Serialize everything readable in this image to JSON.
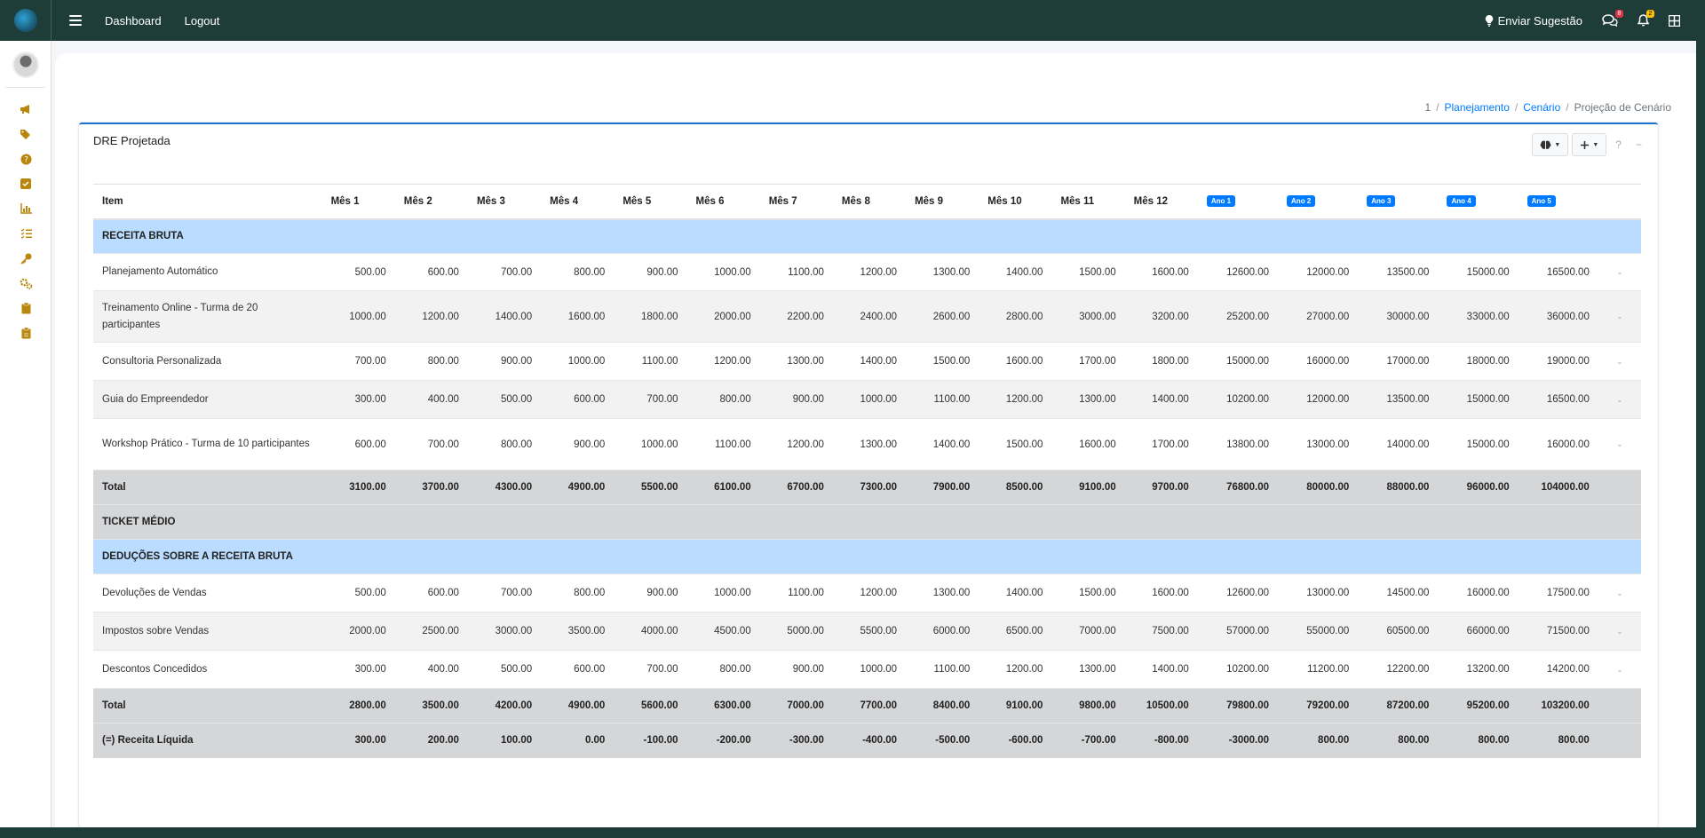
{
  "nav": {
    "dashboard": "Dashboard",
    "logout": "Logout",
    "suggest": "Enviar Sugestão",
    "chat_badge": "8",
    "bell_badge": "2"
  },
  "breadcrumb": {
    "home": "1",
    "planejamento": "Planejamento",
    "cenario": "Cenário",
    "current": "Projeção de Cenário"
  },
  "panel": {
    "title": "DRE Projetada",
    "help": "?",
    "collapse": "−"
  },
  "table": {
    "headers": [
      "Item",
      "Mês 1",
      "Mês 2",
      "Mês 3",
      "Mês 4",
      "Mês 5",
      "Mês 6",
      "Mês 7",
      "Mês 8",
      "Mês 9",
      "Mês 10",
      "Mês 11",
      "Mês 12"
    ],
    "years": [
      "Ano 1",
      "Ano 2",
      "Ano 3",
      "Ano 4",
      "Ano 5"
    ],
    "sections": {
      "receita": "RECEITA BRUTA",
      "ticket": "TICKET MÉDIO",
      "deducoes": "DEDUÇÕES SOBRE A RECEITA BRUTA"
    },
    "total_label": "Total",
    "receita_rows": [
      {
        "item": "Planejamento Automático",
        "values": [
          "500.00",
          "600.00",
          "700.00",
          "800.00",
          "900.00",
          "1000.00",
          "1100.00",
          "1200.00",
          "1300.00",
          "1400.00",
          "1500.00",
          "1600.00",
          "12600.00",
          "12000.00",
          "13500.00",
          "15000.00",
          "16500.00"
        ]
      },
      {
        "item": "Treinamento Online - Turma de 20 participantes",
        "values": [
          "1000.00",
          "1200.00",
          "1400.00",
          "1600.00",
          "1800.00",
          "2000.00",
          "2200.00",
          "2400.00",
          "2600.00",
          "2800.00",
          "3000.00",
          "3200.00",
          "25200.00",
          "27000.00",
          "30000.00",
          "33000.00",
          "36000.00"
        ]
      },
      {
        "item": "Consultoria Personalizada",
        "values": [
          "700.00",
          "800.00",
          "900.00",
          "1000.00",
          "1100.00",
          "1200.00",
          "1300.00",
          "1400.00",
          "1500.00",
          "1600.00",
          "1700.00",
          "1800.00",
          "15000.00",
          "16000.00",
          "17000.00",
          "18000.00",
          "19000.00"
        ]
      },
      {
        "item": "Guia do Empreendedor",
        "values": [
          "300.00",
          "400.00",
          "500.00",
          "600.00",
          "700.00",
          "800.00",
          "900.00",
          "1000.00",
          "1100.00",
          "1200.00",
          "1300.00",
          "1400.00",
          "10200.00",
          "12000.00",
          "13500.00",
          "15000.00",
          "16500.00"
        ]
      },
      {
        "item": "Workshop Prático - Turma de 10 participantes",
        "values": [
          "600.00",
          "700.00",
          "800.00",
          "900.00",
          "1000.00",
          "1100.00",
          "1200.00",
          "1300.00",
          "1400.00",
          "1500.00",
          "1600.00",
          "1700.00",
          "13800.00",
          "13000.00",
          "14000.00",
          "15000.00",
          "16000.00"
        ]
      }
    ],
    "receita_total": [
      "3100.00",
      "3700.00",
      "4300.00",
      "4900.00",
      "5500.00",
      "6100.00",
      "6700.00",
      "7300.00",
      "7900.00",
      "8500.00",
      "9100.00",
      "9700.00",
      "76800.00",
      "80000.00",
      "88000.00",
      "96000.00",
      "104000.00"
    ],
    "deducoes_rows": [
      {
        "item": "Devoluções de Vendas",
        "values": [
          "500.00",
          "600.00",
          "700.00",
          "800.00",
          "900.00",
          "1000.00",
          "1100.00",
          "1200.00",
          "1300.00",
          "1400.00",
          "1500.00",
          "1600.00",
          "12600.00",
          "13000.00",
          "14500.00",
          "16000.00",
          "17500.00"
        ]
      },
      {
        "item": "Impostos sobre Vendas",
        "values": [
          "2000.00",
          "2500.00",
          "3000.00",
          "3500.00",
          "4000.00",
          "4500.00",
          "5000.00",
          "5500.00",
          "6000.00",
          "6500.00",
          "7000.00",
          "7500.00",
          "57000.00",
          "55000.00",
          "60500.00",
          "66000.00",
          "71500.00"
        ]
      },
      {
        "item": "Descontos Concedidos",
        "values": [
          "300.00",
          "400.00",
          "500.00",
          "600.00",
          "700.00",
          "800.00",
          "900.00",
          "1000.00",
          "1100.00",
          "1200.00",
          "1300.00",
          "1400.00",
          "10200.00",
          "11200.00",
          "12200.00",
          "13200.00",
          "14200.00"
        ]
      }
    ],
    "deducoes_total": [
      "2800.00",
      "3500.00",
      "4200.00",
      "4900.00",
      "5600.00",
      "6300.00",
      "7000.00",
      "7700.00",
      "8400.00",
      "9100.00",
      "9800.00",
      "10500.00",
      "79800.00",
      "79200.00",
      "87200.00",
      "95200.00",
      "103200.00"
    ],
    "liquida_label": "(=) Receita Líquida",
    "liquida": [
      "300.00",
      "200.00",
      "100.00",
      "0.00",
      "-100.00",
      "-200.00",
      "-300.00",
      "-400.00",
      "-500.00",
      "-600.00",
      "-700.00",
      "-800.00",
      "-3000.00",
      "800.00",
      "800.00",
      "800.00",
      "800.00"
    ]
  },
  "sidebar_icons": [
    "megaphone-icon",
    "tags-icon",
    "help-circle-icon",
    "check-square-icon",
    "chart-bar-icon",
    "list-check-icon",
    "key-icon",
    "cogs-icon",
    "clipboard-icon",
    "clipboard-alt-icon"
  ]
}
